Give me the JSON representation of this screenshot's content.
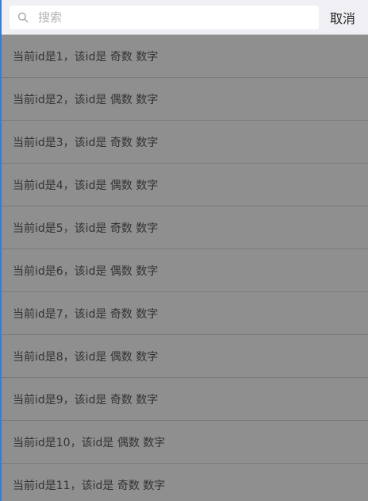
{
  "search": {
    "placeholder": "搜索",
    "value": "",
    "cancel_label": "取消"
  },
  "list": {
    "items": [
      {
        "label": "当前id是1，该id是 奇数 数字"
      },
      {
        "label": "当前id是2，该id是 偶数 数字"
      },
      {
        "label": "当前id是3，该id是 奇数 数字"
      },
      {
        "label": "当前id是4，该id是 偶数 数字"
      },
      {
        "label": "当前id是5，该id是 奇数 数字"
      },
      {
        "label": "当前id是6，该id是 偶数 数字"
      },
      {
        "label": "当前id是7，该id是 奇数 数字"
      },
      {
        "label": "当前id是8，该id是 偶数 数字"
      },
      {
        "label": "当前id是9，该id是 奇数 数字"
      },
      {
        "label": "当前id是10，该id是 偶数 数字"
      },
      {
        "label": "当前id是11，该id是 奇数 数字"
      }
    ]
  },
  "colors": {
    "overlay": "#8f8f8f",
    "accent_border": "#3d7cc9",
    "search_bar_bg": "#efeff4"
  },
  "icons": {
    "search": "search-icon"
  }
}
